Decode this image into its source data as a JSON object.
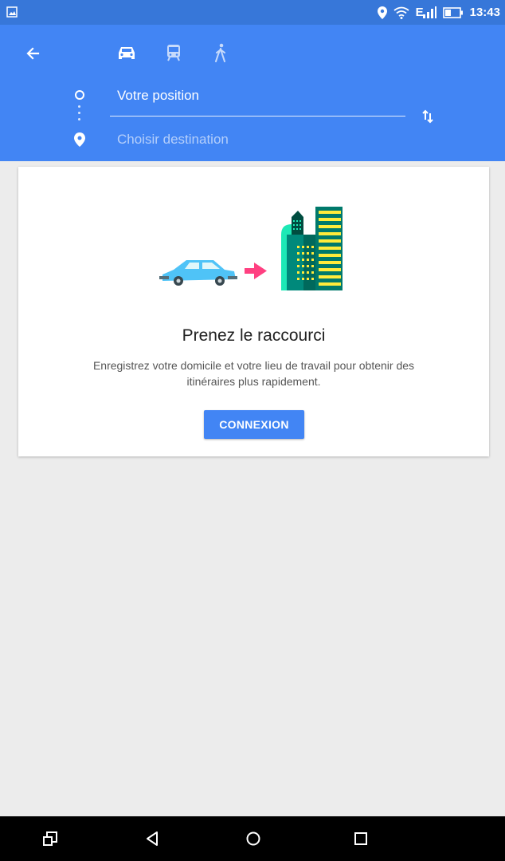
{
  "status_bar": {
    "time": "13:43",
    "network": "E",
    "icons": [
      "image-icon",
      "location-icon",
      "wifi-icon",
      "signal-icon",
      "battery-icon"
    ]
  },
  "header": {
    "back_icon": "arrow-left-icon",
    "modes": [
      {
        "name": "car",
        "icon": "car-icon",
        "selected": true
      },
      {
        "name": "transit",
        "icon": "train-icon",
        "selected": false
      },
      {
        "name": "walk",
        "icon": "walk-icon",
        "selected": false
      }
    ],
    "origin": "Votre position",
    "destination_placeholder": "Choisir destination",
    "swap_icon": "swap-icon",
    "color": "#4285f4"
  },
  "card": {
    "title": "Prenez le raccourci",
    "description": "Enregistrez votre domicile et votre lieu de travail pour obtenir des itinéraires plus rapidement.",
    "button_label": "CONNEXION"
  },
  "nav_bar": {
    "icons": [
      "recent-apps-alt-icon",
      "back-icon",
      "home-icon",
      "overview-icon"
    ]
  }
}
